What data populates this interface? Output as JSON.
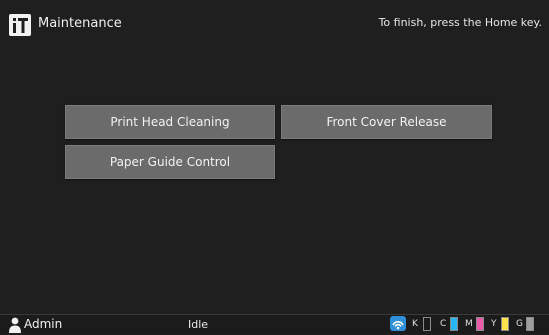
{
  "header": {
    "title": "Maintenance",
    "hint": "To finish, press the Home key."
  },
  "buttons": [
    {
      "label": "Print Head Cleaning"
    },
    {
      "label": "Front Cover Release"
    },
    {
      "label": "Paper Guide Control"
    }
  ],
  "statusbar": {
    "user": "Admin",
    "status": "Idle",
    "toner": [
      {
        "letter": "K",
        "color": "#1b1b1b",
        "level": 0.0
      },
      {
        "letter": "C",
        "color": "#29b6f6",
        "level": 1.0
      },
      {
        "letter": "M",
        "color": "#ec5aa8",
        "level": 1.0
      },
      {
        "letter": "Y",
        "color": "#ffe34d",
        "level": 1.0
      },
      {
        "letter": "G",
        "color": "#9e9e9e",
        "level": 1.0
      }
    ]
  },
  "icons": {
    "app": "maintenance-tools-icon",
    "user": "user-icon",
    "wifi": "wireless-icon"
  }
}
